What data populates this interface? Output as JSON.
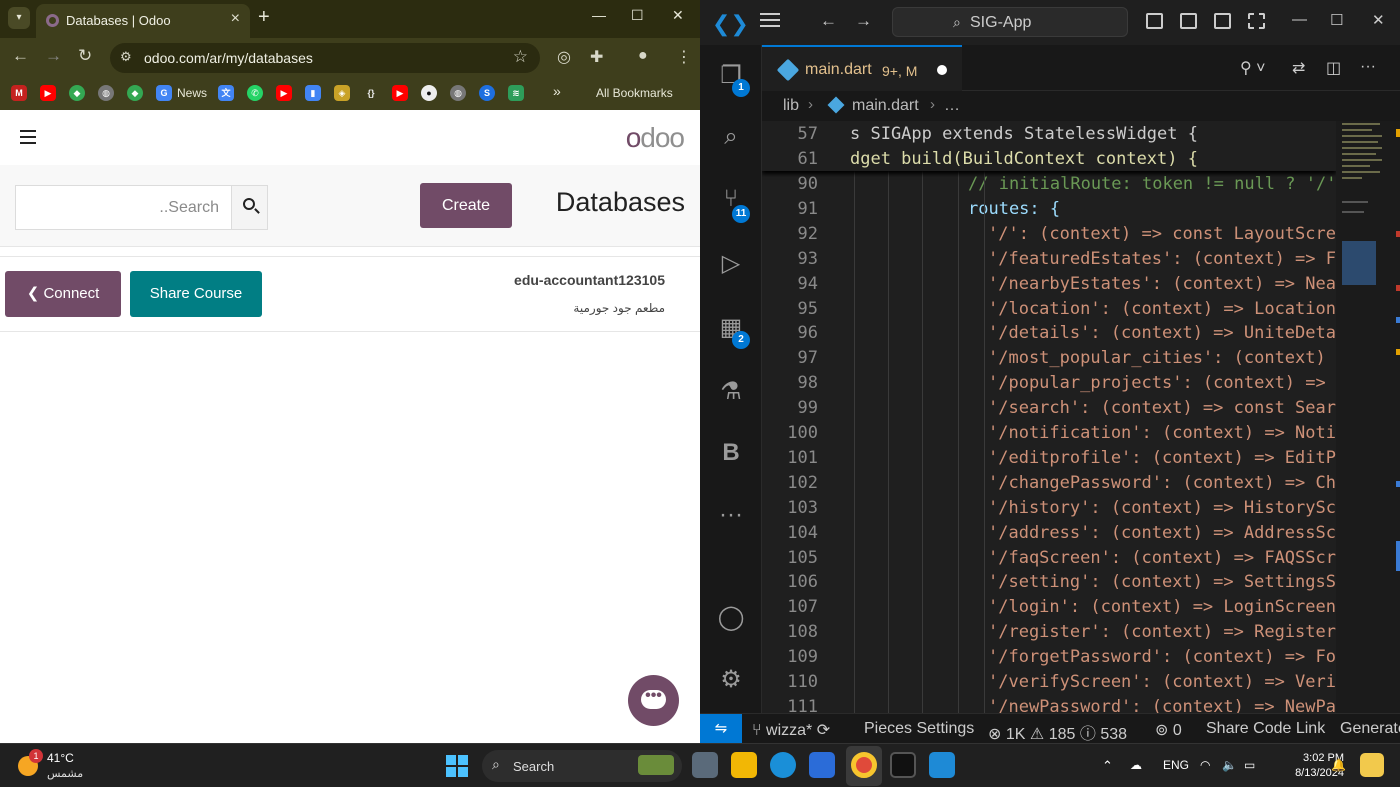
{
  "browser": {
    "tab_title": "Databases | Odoo",
    "url": "odoo.com/ar/my/databases",
    "bookmarks_news": "News",
    "bookmarks_all": "All Bookmarks"
  },
  "odoo": {
    "logo": "odoo",
    "search_placeholder": "..Search",
    "create_label": "Create",
    "page_title": "Databases",
    "connect_label": "Connect",
    "share_label": "Share Course",
    "db_name": "edu-accountant123105",
    "db_subtitle": "مطعم جود جورمية",
    "colors": {
      "primary": "#714b67",
      "teal": "#017e84"
    }
  },
  "vscode": {
    "command_center": "SIG-App",
    "tab_name": "main.dart",
    "tab_status": "9+, M",
    "breadcrumb_folder": "lib",
    "breadcrumb_file": "main.dart",
    "breadcrumb_more": "…",
    "badges": {
      "explorer": "1",
      "source_control": "11",
      "extensions": "2"
    },
    "sticky_lines": [
      {
        "n": "57",
        "text": "s SIGApp extends StatelessWidget {"
      },
      {
        "n": "61",
        "text": "dget build(BuildContext context) {"
      }
    ],
    "lines": [
      {
        "n": "90",
        "text": "// initialRoute: token != null ? '/' :"
      },
      {
        "n": "91",
        "text": "routes: {"
      },
      {
        "n": "92",
        "text": "'/': (context) => const LayoutScree"
      },
      {
        "n": "93",
        "text": "'/featuredEstates': (context) => Fe"
      },
      {
        "n": "94",
        "text": "'/nearbyEstates': (context) => Near"
      },
      {
        "n": "95",
        "text": "'/location': (context) => Location("
      },
      {
        "n": "96",
        "text": "'/details': (context) => UniteDetai"
      },
      {
        "n": "97",
        "text": "'/most_popular_cities': (context) ="
      },
      {
        "n": "98",
        "text": "'/popular_projects': (context) => P"
      },
      {
        "n": "99",
        "text": "'/search': (context) => const Searc"
      },
      {
        "n": "100",
        "text": "'/notification': (context) => Notif"
      },
      {
        "n": "101",
        "text": "'/editprofile': (context) => EditPr"
      },
      {
        "n": "102",
        "text": "'/changePassword': (context) => Cha"
      },
      {
        "n": "103",
        "text": "'/history': (context) => HistoryScr"
      },
      {
        "n": "104",
        "text": "'/address': (context) => AddressScr"
      },
      {
        "n": "105",
        "text": "'/faqScreen': (context) => FAQSScre"
      },
      {
        "n": "106",
        "text": "'/setting': (context) => SettingsSc"
      },
      {
        "n": "107",
        "text": "'/login': (context) => LoginScreen("
      },
      {
        "n": "108",
        "text": "'/register': (context) => RegisterS"
      },
      {
        "n": "109",
        "text": "'/forgetPassword': (context) => For"
      },
      {
        "n": "110",
        "text": "'/verifyScreen': (context) => Verif"
      },
      {
        "n": "111",
        "text": "'/newPassword': (context) => NewPas"
      }
    ],
    "status": {
      "branch": "wizza*",
      "pieces": "Pieces Settings",
      "errors": "1K",
      "warnings": "185",
      "infos": "538",
      "ports": "0",
      "share": "Share Code Link",
      "generate": "Generate"
    }
  },
  "taskbar": {
    "temperature": "41°C",
    "condition": "مشمس",
    "weather_badge": "1",
    "search_label": "Search",
    "lang": "ENG",
    "time": "3:02 PM",
    "date": "8/13/2024"
  }
}
